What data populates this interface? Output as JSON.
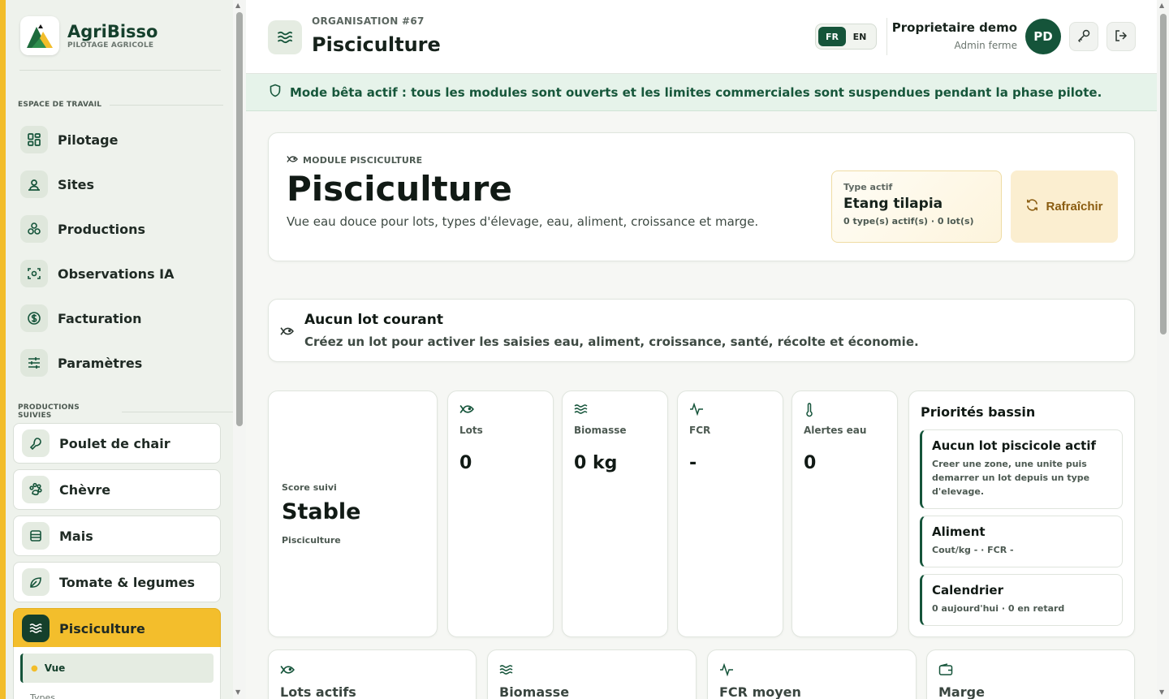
{
  "brand": {
    "name": "AgriBisso",
    "tagline": "PILOTAGE AGRICOLE"
  },
  "sidebar": {
    "workspace_label": "ESPACE DE TRAVAIL",
    "nav": [
      {
        "label": "Pilotage",
        "icon": "grid-icon"
      },
      {
        "label": "Sites",
        "icon": "location-icon"
      },
      {
        "label": "Productions",
        "icon": "cluster-icon"
      },
      {
        "label": "Observations IA",
        "icon": "scan-icon"
      },
      {
        "label": "Facturation",
        "icon": "dollar-icon"
      },
      {
        "label": "Paramètres",
        "icon": "sliders-icon"
      }
    ],
    "productions_label": "PRODUCTIONS SUIVIES",
    "productions": [
      {
        "label": "Poulet de chair",
        "icon": "drumstick-icon"
      },
      {
        "label": "Chèvre",
        "icon": "paw-icon"
      },
      {
        "label": "Mais",
        "icon": "corn-icon"
      },
      {
        "label": "Tomate & legumes",
        "icon": "leaf-icon"
      },
      {
        "label": "Pisciculture",
        "icon": "waves-icon",
        "active": true
      }
    ],
    "sub_items": {
      "active": "Vue",
      "next": "Types"
    }
  },
  "header": {
    "org_label": "ORGANISATION #67",
    "title": "Pisciculture",
    "lang": {
      "fr": "FR",
      "en": "EN",
      "selected": "FR"
    },
    "user_name": "Proprietaire demo",
    "user_role": "Admin ferme",
    "avatar_initials": "PD"
  },
  "beta_banner": "Mode bêta actif : tous les modules sont ouverts et les limites commerciales sont suspendues pendant la phase pilote.",
  "hero": {
    "kicker": "MODULE PISCICULTURE",
    "title": "Pisciculture",
    "description": "Vue eau douce pour lots, types d'élevage, eau, aliment, croissance et marge.",
    "type_label": "Type actif",
    "type_value": "Etang tilapia",
    "type_meta": "0 type(s) actif(s) · 0 lot(s)",
    "refresh_label": "Rafraîchir"
  },
  "no_lot": {
    "title": "Aucun lot courant",
    "description": "Créez un lot pour activer les saisies eau, aliment, croissance, santé, récolte et économie."
  },
  "score": {
    "label": "Score suivi",
    "value": "Stable",
    "sub": "Pisciculture"
  },
  "kpis": [
    {
      "label": "Lots",
      "value": "0",
      "icon": "fish-icon"
    },
    {
      "label": "Biomasse",
      "value": "0 kg",
      "icon": "waves-icon"
    },
    {
      "label": "FCR",
      "value": "-",
      "icon": "pulse-icon"
    },
    {
      "label": "Alertes eau",
      "value": "0",
      "icon": "thermometer-icon"
    }
  ],
  "priorities": {
    "title": "Priorités bassin",
    "items": [
      {
        "title": "Aucun lot piscicole actif",
        "text": "Creer une zone, une unite puis demarrer un lot depuis un type d'elevage."
      },
      {
        "title": "Aliment",
        "text": "Cout/kg - · FCR -"
      },
      {
        "title": "Calendrier",
        "text": "0 aujourd'hui · 0 en retard"
      }
    ]
  },
  "bottom_cards": [
    {
      "label": "Lots actifs",
      "icon": "fish-icon"
    },
    {
      "label": "Biomasse",
      "icon": "waves-icon"
    },
    {
      "label": "FCR moyen",
      "icon": "pulse-icon"
    },
    {
      "label": "Marge",
      "icon": "wallet-icon"
    }
  ],
  "colors": {
    "brand_green": "#15543a",
    "accent_yellow": "#f2bd2a",
    "beta_bg": "#e6f3ea"
  }
}
